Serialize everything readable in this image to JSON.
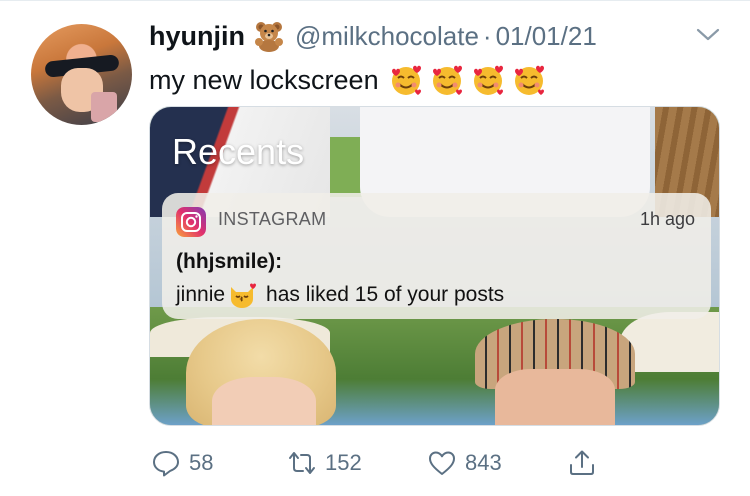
{
  "tweet": {
    "display_name": "hyunjin",
    "name_emoji": "teddy-bear-emoji",
    "handle": "@milkchocolate",
    "separator": "·",
    "date": "01/01/21",
    "text": "my new lockscreen",
    "text_emojis": [
      "smiling-face-with-hearts-emoji",
      "smiling-face-with-hearts-emoji",
      "smiling-face-with-hearts-emoji",
      "smiling-face-with-hearts-emoji"
    ]
  },
  "media": {
    "recents_label": "Recents",
    "notification": {
      "app_name": "INSTAGRAM",
      "time": "1h ago",
      "sender": "(hhjsmile):",
      "message_prefix": "jinnie",
      "message_emoji": "kissing-cat-face-emoji",
      "message_suffix": "has liked 15 of your posts"
    }
  },
  "actions": {
    "reply_count": "58",
    "retweet_count": "152",
    "like_count": "843",
    "icons": [
      "reply-icon",
      "retweet-icon",
      "like-icon",
      "share-icon"
    ]
  },
  "colors": {
    "text_primary": "#0f1419",
    "text_secondary": "#5b7083",
    "instagram_gradient": [
      "#f9a33b",
      "#e1306c",
      "#833ab4"
    ]
  }
}
